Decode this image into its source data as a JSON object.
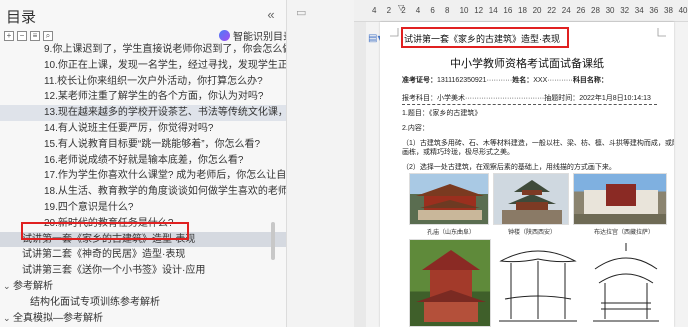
{
  "outline": {
    "title": "目录",
    "collapse_icon": "«",
    "smart_button": "智能识别目录",
    "items": [
      {
        "text": "9.你上课迟到了，学生直接说老师你迟到了，你会怎么做?",
        "level": "l2"
      },
      {
        "text": "10.你正在上课，发现一名学生，经过寻找，发现学生正...",
        "level": "l2"
      },
      {
        "text": "11.校长让你来组织一次户外活动，你打算怎么办?",
        "level": "l2"
      },
      {
        "text": "12.某老师注重了解学生的各个方面，你认为对吗?",
        "level": "l2"
      },
      {
        "text": "13.现在越来越多的学校开设茶艺、书法等传统文化课，你...",
        "level": "l2"
      },
      {
        "text": "14.有人说班主任要严厉，你觉得对吗?",
        "level": "l2"
      },
      {
        "text": "15.有人说教育目标要“跳一跳能够着”，你怎么看?",
        "level": "l2"
      },
      {
        "text": "16.老师说成绩不好就是输本底差，你怎么看?",
        "level": "l2"
      },
      {
        "text": "17.作为学生你喜欢什么课堂? 成为老师后，你怎么让自己...",
        "level": "l2"
      },
      {
        "text": "18.从生活、教育教学的角度谈谈如何做学生喜欢的老师?",
        "level": "l2"
      },
      {
        "text": "19.四个意识是什么?",
        "level": "l2"
      },
      {
        "text": "20.新时代的教育任务是什么?",
        "level": "l2"
      },
      {
        "text": "试讲第一套《家乡的古建筑》造型·表现",
        "level": "l1"
      },
      {
        "text": "试讲第二套《神奇的民居》造型·表现",
        "level": "l1"
      },
      {
        "text": "试讲第三套《送你一个小书签》设计·应用",
        "level": "l1"
      },
      {
        "text": "参考解析",
        "level": "l0"
      },
      {
        "text": "结构化面试专项训练参考解析",
        "level": "sub"
      },
      {
        "text": "全真模拟—参考解析",
        "level": "l0"
      },
      {
        "text": "结构化面试第一组参考解析",
        "level": "sub"
      }
    ]
  },
  "ruler": {
    "ticks": [
      "4",
      "2",
      "2",
      "4",
      "6",
      "8",
      "10",
      "12",
      "14",
      "16",
      "18",
      "20",
      "22",
      "24",
      "26",
      "28",
      "30",
      "32",
      "34",
      "36",
      "38",
      "40"
    ]
  },
  "document": {
    "heading": "试讲第一套《家乡的古建筑》造型·表现",
    "title": "中小学教师资格考试面试备课纸",
    "exam_no_label": "准考证号：",
    "exam_no": "1311162350921",
    "name_label": "姓名：",
    "name_value": "XXX",
    "subject_label": "科目名称：",
    "subject_value": "",
    "line2": "报考科目：小学美术··································抽题时间：2022年1月8日10:14:13",
    "topic": "1.题目：《家乡的古建筑》",
    "content_label": "2.内容：",
    "para1": "（1）古建筑多用砖、石、木等材料建造，一般以柱、梁、枋、檩、斗拱等建构而成，或雕梁",
    "para1b": "画栋，或精巧玲珑，极尽形式之美。",
    "para2": "（2）选择一处古建筑，在观察后素的基础上，用线描的方式画下来。",
    "captions": [
      "孔庙（山东曲阜）",
      "钟楼（陕西西安）",
      "布达拉宫（西藏拉萨）"
    ]
  }
}
